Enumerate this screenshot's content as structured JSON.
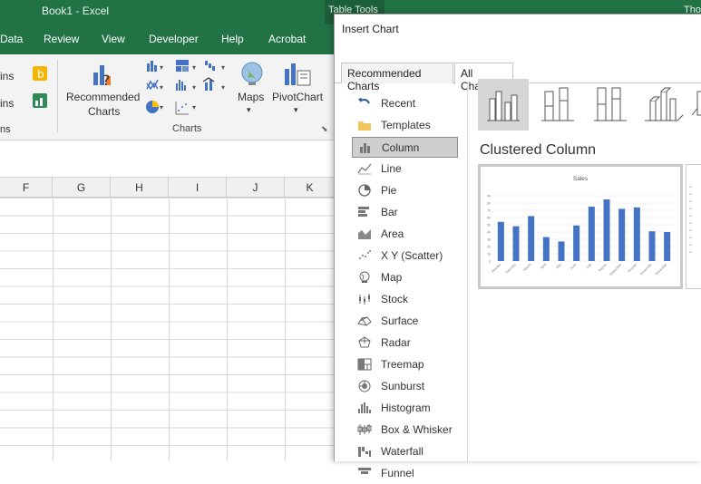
{
  "window": {
    "title": "Book1  -  Excel",
    "table_tools": "Table Tools",
    "user": "Tho"
  },
  "ribbon_tabs": [
    "Data",
    "Review",
    "View",
    "Developer",
    "Help",
    "Acrobat"
  ],
  "ribbon": {
    "left_partial_labels": [
      "ins",
      "ins",
      "ns"
    ],
    "recommended_charts": [
      "Recommended",
      "Charts"
    ],
    "maps": "Maps",
    "pivotchart": "PivotChart",
    "charts_group": "Charts"
  },
  "grid": {
    "columns": [
      "F",
      "G",
      "H",
      "I",
      "J",
      "K"
    ]
  },
  "dialog": {
    "title": "Insert Chart",
    "tabs": [
      "Recommended Charts",
      "All Charts"
    ],
    "active_tab": "All Charts",
    "categories": [
      "Recent",
      "Templates",
      "Column",
      "Line",
      "Pie",
      "Bar",
      "Area",
      "X Y (Scatter)",
      "Map",
      "Stock",
      "Surface",
      "Radar",
      "Treemap",
      "Sunburst",
      "Histogram",
      "Box & Whisker",
      "Waterfall",
      "Funnel"
    ],
    "selected_category": "Column",
    "chart_type_name": "Clustered Column",
    "preview_chart_title": "Sales"
  },
  "chart_data": {
    "type": "bar",
    "title": "Sales",
    "categories": [
      "January",
      "February",
      "March",
      "April",
      "May",
      "June",
      "July",
      "August",
      "September",
      "October",
      "November",
      "December"
    ],
    "values": [
      54,
      48,
      62,
      33,
      27,
      49,
      75,
      85,
      72,
      74,
      41,
      40
    ],
    "ylim": [
      0,
      100
    ],
    "y_ticks": [
      0,
      10,
      20,
      30,
      40,
      50,
      60,
      70,
      80,
      90
    ],
    "bar_color": "#4472c4",
    "grid": true
  },
  "colors": {
    "excel_green": "#217346",
    "selected_gray": "#cfcfcf",
    "accent_blue": "#4472c4"
  }
}
